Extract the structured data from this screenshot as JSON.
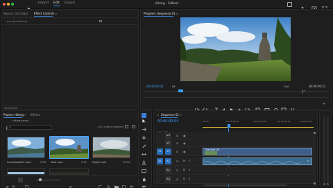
{
  "app": {
    "title": "Hiking - Edited"
  },
  "menu": {
    "home_icon": "home-icon",
    "import": "Import",
    "edit": "Edit",
    "export": "Export"
  },
  "source_panel": {
    "tab_source": "Source: (no clips)",
    "tab_effect_controls": "Effect Controls",
    "no_clip": "(no clip selected)",
    "timecode": "00;00;00;00"
  },
  "program": {
    "tab": "Program: Sequence 01",
    "timecode_left": "00:00:00:04",
    "zoom": "Fit",
    "quality": "Full",
    "timecode_right": "00:00:00:21"
  },
  "project": {
    "tab_project": "Project: Hiking",
    "tab_effects": "Effects",
    "folder": "Hiking.prproj",
    "selection_status": "1 of 10 items selected",
    "items": [
      {
        "name": "CrossGuate01.mp4",
        "duration": "2:05"
      },
      {
        "name": "Tikal.mp4",
        "duration": "5:11"
      },
      {
        "name": "Fog01.mp4",
        "duration": "14:10"
      }
    ]
  },
  "timeline": {
    "tab": "Sequence 01",
    "timecode": "00:00:00:04",
    "ruler": [
      "00:00",
      "00:00:00:04",
      "00:00:00:08",
      "00:00:00:12",
      "00:00:00:16"
    ],
    "tracks": [
      "V3",
      "V2",
      "V1",
      "A1",
      "A2",
      "A3"
    ],
    "clip_video": "Tikal.mp4 [V]",
    "clip_audio": "fx"
  },
  "colors": {
    "accent": "#2d8ceb",
    "video_clip": "#3f5f8a",
    "audio_clip": "#3c6a8c",
    "track_target": "#2b6db8"
  }
}
